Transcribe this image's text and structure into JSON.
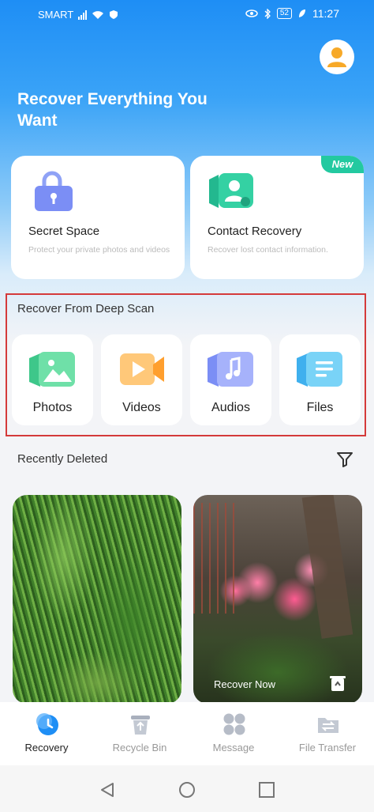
{
  "status_bar": {
    "carrier": "SMART",
    "battery": "52",
    "time": "11:27"
  },
  "hero": {
    "title": "Recover Everything You Want"
  },
  "feature_cards": [
    {
      "title": "Secret Space",
      "desc": "Protect your private photos and videos",
      "icon": "lock-icon"
    },
    {
      "title": "Contact Recovery",
      "desc": "Recover lost contact information.",
      "icon": "contact-icon",
      "badge": "New"
    }
  ],
  "deep_scan": {
    "title": "Recover From Deep Scan",
    "items": [
      {
        "label": "Photos",
        "icon": "photo-icon"
      },
      {
        "label": "Videos",
        "icon": "video-icon"
      },
      {
        "label": "Audios",
        "icon": "audio-icon"
      },
      {
        "label": "Files",
        "icon": "file-icon"
      }
    ]
  },
  "recently_deleted": {
    "title": "Recently Deleted",
    "recover_now": "Recover Now"
  },
  "bottom_nav": [
    {
      "label": "Recovery",
      "icon": "recovery-icon",
      "active": true
    },
    {
      "label": "Recycle Bin",
      "icon": "recycle-bin-icon",
      "active": false
    },
    {
      "label": "Message",
      "icon": "message-icon",
      "active": false
    },
    {
      "label": "File Transfer",
      "icon": "file-transfer-icon",
      "active": false
    }
  ],
  "colors": {
    "accent": "#1e8ef5",
    "highlight_border": "#d43a3a",
    "new_badge": "#23c9a0"
  }
}
